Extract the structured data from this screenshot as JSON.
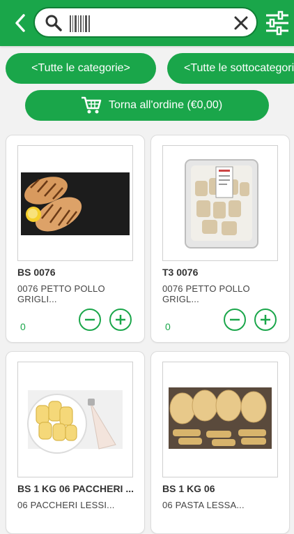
{
  "header": {
    "search_placeholder": ""
  },
  "filters": {
    "categories_label": "<Tutte le categorie>",
    "subcategories_label": "<Tutte le sottocategorie"
  },
  "order": {
    "label": "Torna all'ordine (€0,00)"
  },
  "products": [
    {
      "code": "BS 0076",
      "description": "0076 PETTO POLLO GRIGLI...",
      "quantity": "0",
      "image": "grilled-chicken-breast"
    },
    {
      "code": "T3 0076",
      "description": "0076 PETTO POLLO GRIGL...",
      "quantity": "0",
      "image": "packaged-grilled-chicken"
    },
    {
      "code": "BS 1 KG 06 PACCHERI ...",
      "description": "06 PACCHERI LESSI...",
      "quantity": "",
      "image": "paccheri-pasta"
    },
    {
      "code": "BS 1 KG 06",
      "description": "06 PASTA LESSA...",
      "quantity": "",
      "image": "assorted-pasta"
    }
  ],
  "colors": {
    "primary": "#1aa64a",
    "primary_dark": "#0f7f35",
    "background": "#f2f2f2"
  }
}
